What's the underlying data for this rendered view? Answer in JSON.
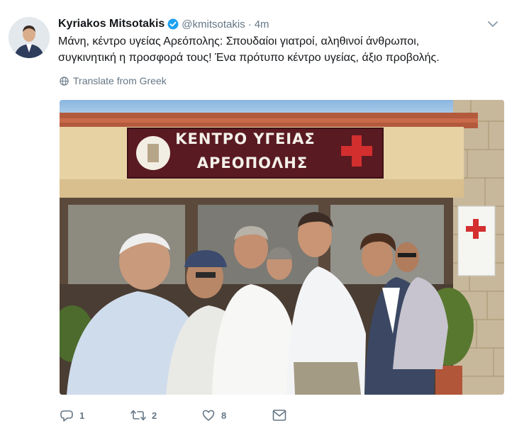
{
  "tweet": {
    "author_name": "Kyriakos Mitsotakis",
    "handle": "@kmitsotakis",
    "separator": "·",
    "time": "4m",
    "text_line1": "Μάνη, κέντρο υγείας Αρεόπολης: Σπουδαίοι γιατροί, αληθινοί άνθρωποι,",
    "text_line2": "συγκινητική η προσφορά τους! Ένα πρότυπο κέντρο υγείας, άξιο προβολής.",
    "translate_label": "Translate from Greek",
    "verified": true
  },
  "photo": {
    "sign_line1": "ΚΕΝΤΡΟ ΥΓΕΙΑΣ",
    "sign_line2": "ΑΡΕΟΠΟΛΗΣ"
  },
  "actions": {
    "reply_count": "1",
    "retweet_count": "2",
    "like_count": "8"
  },
  "colors": {
    "verified_blue": "#1da1f2",
    "muted_gray": "#657786",
    "text_dark": "#14171a",
    "sign_maroon": "#5a1a22",
    "red_cross": "#d32f2f"
  },
  "icons": [
    "chevron-down-icon",
    "verified-badge-icon",
    "globe-icon",
    "reply-icon",
    "retweet-icon",
    "like-icon",
    "direct-message-icon"
  ]
}
